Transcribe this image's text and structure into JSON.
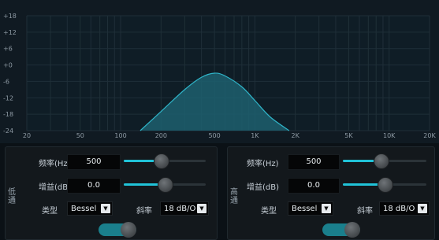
{
  "graph": {
    "y_ticks": [
      "+18",
      "+12",
      "+6",
      "+0",
      "-6",
      "-12",
      "-18",
      "-24"
    ],
    "x_ticks": [
      "20",
      "50",
      "100",
      "200",
      "500",
      "1K",
      "2K",
      "5K",
      "10K",
      "20K"
    ],
    "colors": {
      "curve_fill": "#1d5f6f",
      "curve_stroke": "#2fb4c8",
      "grid": "#1f2f38"
    }
  },
  "chart_data": {
    "type": "area",
    "xscale": "log",
    "xlim": [
      20,
      20000
    ],
    "ylim": [
      -24,
      18
    ],
    "x": [
      140,
      200,
      300,
      400,
      500,
      600,
      800,
      1000,
      1300,
      1800
    ],
    "y": [
      -24,
      -17,
      -9,
      -4.5,
      -3,
      -4,
      -8,
      -13,
      -19,
      -24
    ]
  },
  "low": {
    "side_label": "低通",
    "freq_label": "频率(Hz)",
    "freq_value": "500",
    "freq_slider": 0.45,
    "gain_label": "增益(dB)",
    "gain_value": "0.0",
    "gain_slider": 0.5,
    "type_label": "类型",
    "type_value": "Bessel",
    "slope_label": "斜率",
    "slope_value": "18 dB/O",
    "enabled": true
  },
  "high": {
    "side_label": "高通",
    "freq_label": "频率(Hz)",
    "freq_value": "500",
    "freq_slider": 0.45,
    "gain_label": "增益(dB)",
    "gain_value": "0.0",
    "gain_slider": 0.5,
    "type_label": "类型",
    "type_value": "Bessel",
    "slope_label": "斜率",
    "slope_value": "18 dB/O",
    "enabled": true
  }
}
